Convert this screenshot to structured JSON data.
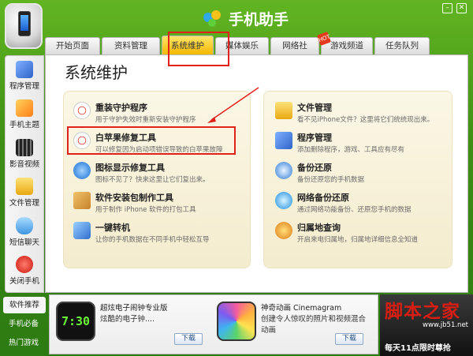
{
  "window": {
    "title": "手机助手",
    "minimize_icon": "minimize-icon",
    "close_icon": "close-icon"
  },
  "tabs": [
    {
      "label": "开始页面"
    },
    {
      "label": "资料管理"
    },
    {
      "label": "系统维护",
      "active": true
    },
    {
      "label": "媒体娱乐"
    },
    {
      "label": "网络社区"
    },
    {
      "label": "游戏频道",
      "badge": "HOT"
    },
    {
      "label": "任务队列"
    }
  ],
  "sidebar": [
    {
      "label": "程序管理",
      "icon": "apps-icon",
      "color": "#3b78d8"
    },
    {
      "label": "手机主题",
      "icon": "theme-icon",
      "color": "#ff8c1a"
    },
    {
      "label": "影音视频",
      "icon": "film-icon",
      "color": "#333333"
    },
    {
      "label": "文件管理",
      "icon": "folder-icon",
      "color": "#f2b51c"
    },
    {
      "label": "短信聊天",
      "icon": "sms-icon",
      "color": "#4aa3e8"
    },
    {
      "label": "关闭手机",
      "icon": "power-icon",
      "color": "#d9261b"
    }
  ],
  "main": {
    "title": "系统维护"
  },
  "tools_left": [
    {
      "title": "重装守护程序",
      "desc": "用于守护失效时重新安装守护程序",
      "icon": "first-aid-icon"
    },
    {
      "title": "白苹果修复工具",
      "desc": "可以修复因为启动项错误导致的白苹果故障",
      "icon": "first-aid-icon"
    },
    {
      "title": "图标显示修复工具",
      "desc": "图标不见了？快来这里让它们复出来。",
      "icon": "icon-repair-icon"
    },
    {
      "title": "软件安装包制作工具",
      "desc": "用于制作 iPhone 软件的打包工具",
      "icon": "package-icon"
    },
    {
      "title": "一键转机",
      "desc": "让你的手机数据在不同手机中轻松互导",
      "icon": "transfer-icon"
    }
  ],
  "tools_right": [
    {
      "title": "文件管理",
      "desc": "看不见iPhone文件？这里将它们统统现出来。",
      "icon": "folder-icon"
    },
    {
      "title": "程序管理",
      "desc": "添加删除程序，游戏、工具应有尽有",
      "icon": "apps-icon"
    },
    {
      "title": "备份还原",
      "desc": "备份还原您的手机数据",
      "icon": "backup-icon"
    },
    {
      "title": "网络备份还原",
      "desc": "通过网络功能备份、还原您手机的数据",
      "icon": "cloud-backup-icon"
    },
    {
      "title": "归属地查询",
      "desc": "开启来电归属地，归属地详细信息全知道",
      "icon": "location-icon"
    }
  ],
  "bottom_tabs": [
    {
      "label": "软件推荐",
      "active": true
    },
    {
      "label": "手机必备"
    },
    {
      "label": "热门游戏"
    }
  ],
  "apps": [
    {
      "name": "超炫电子闹钟专业版",
      "desc": "炫酷的电子钟....",
      "clock": "7:30",
      "download": "下载",
      "icon": "clock-app-icon"
    },
    {
      "name": "神奇动画 Cinemagram",
      "desc": "创建令人惊叹的照片和视频混合动画",
      "download": "下载",
      "icon": "cinemagram-app-icon"
    }
  ],
  "ad": {
    "brand": "脚本之家",
    "site": "www.jb51.net",
    "promo": "每天11点限时尊抢"
  },
  "colors": {
    "accent_red": "#e3211b",
    "active_tab": "#f4b800",
    "frame_green": "#3f8f16"
  }
}
